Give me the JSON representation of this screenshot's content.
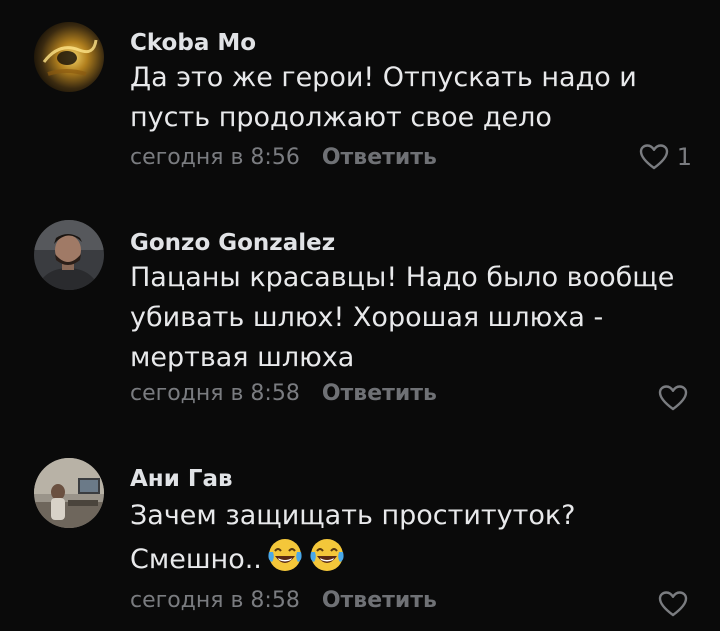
{
  "comments": [
    {
      "author": "Ckoba Mo",
      "text": "Да это же герои! Отпускать надо и пусть продолжают свое дело",
      "time": "сегодня в 8:56",
      "reply_label": "Ответить",
      "likes": "1"
    },
    {
      "author": "Gonzo Gonzalez",
      "text": "Пацаны красавцы! Надо было вообще убивать шлюх! Хорошая шлюха - мертвая шлюха",
      "time": "сегодня в 8:58",
      "reply_label": "Ответить"
    },
    {
      "author": "Ани Гав",
      "text": "Зачем защищать проституток? Смешно..",
      "emoji": [
        "face-with-tears-of-joy",
        "face-with-tears-of-joy"
      ],
      "time": "сегодня в 8:58",
      "reply_label": "Ответить"
    }
  ],
  "icons": {
    "like": "heart-outline-icon"
  },
  "colors": {
    "background": "#0a0a0a",
    "text": "#e8e9eb",
    "secondary": "#7a7c80"
  }
}
